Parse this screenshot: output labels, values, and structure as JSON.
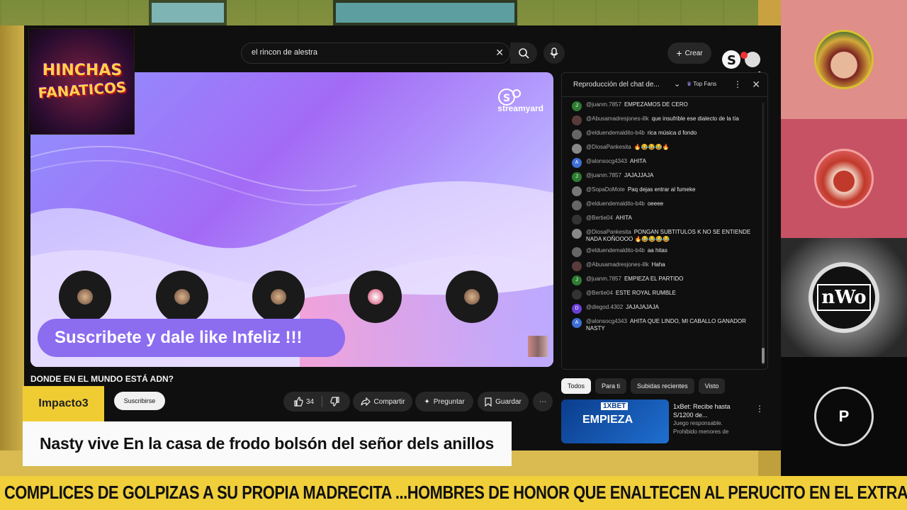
{
  "youtube": {
    "search_query": "el rincon de alestra",
    "create_label": "Crear",
    "streamyard_label": "streamyard",
    "video": {
      "banner_text": "Suscribete y dale like Infeliz !!!",
      "title": "DONDE EN EL MUNDO ESTÁ ADN?",
      "subscribe_label": "Suscribirse",
      "likes": "34",
      "share_label": "Compartir",
      "ask_label": "Preguntar",
      "save_label": "Guardar"
    },
    "chat": {
      "title": "Reproducción del chat de...",
      "top_fans": "Top Fans",
      "messages": [
        {
          "user": "@juanm.7857",
          "text": "EMPEZAMOS DE CERO",
          "initial": "J",
          "color": "#2e7d32"
        },
        {
          "user": "@Abusamadresjones-illk",
          "text": "que insufrible ese dialecto de la tía",
          "initial": "",
          "color": "#5a3b3b"
        },
        {
          "user": "@elduendemaldito-b4b",
          "text": "rica música d fondo",
          "initial": "",
          "color": "#666666"
        },
        {
          "user": "@DiosaPankesita",
          "text": "🔥😂😂😂🔥",
          "initial": "",
          "color": "#888888"
        },
        {
          "user": "@alonsocg4343",
          "text": "AHITA",
          "initial": "A",
          "color": "#3f6fd6"
        },
        {
          "user": "@juanm.7857",
          "text": "JAJAJJAJA",
          "initial": "J",
          "color": "#2e7d32"
        },
        {
          "user": "@SopaDoMote",
          "text": "Paq dejas entrar al fumeke",
          "initial": "",
          "color": "#777777"
        },
        {
          "user": "@elduendemaldito-b4b",
          "text": "oeeee",
          "initial": "",
          "color": "#666666"
        },
        {
          "user": "@Bertie04",
          "text": "AHITA",
          "initial": "",
          "color": "#333333"
        },
        {
          "user": "@DiosaPankesita",
          "text": "PONGAN SUBTITULOS K NO SE ENTIENDE NADA KOÑOOOO 🔥😂😂😂😂",
          "initial": "",
          "color": "#888888"
        },
        {
          "user": "@elduendemaldito-b4b",
          "text": "aa hitas",
          "initial": "",
          "color": "#666666"
        },
        {
          "user": "@Abusamadresjones-illk",
          "text": "Haha",
          "initial": "",
          "color": "#5a3b3b"
        },
        {
          "user": "@juanm.7857",
          "text": "EMPIEZA EL PARTIDO",
          "initial": "J",
          "color": "#2e7d32"
        },
        {
          "user": "@Bertie04",
          "text": "ESTE ROYAL RUMBLE",
          "initial": "",
          "color": "#333333"
        },
        {
          "user": "@diegod.4302",
          "text": "JAJAJAJAJA",
          "initial": "D",
          "color": "#6a3fd6"
        },
        {
          "user": "@alonsocg4343",
          "text": "AHITA QUE LINDO, MI CABALLO GANADOR NASTY",
          "initial": "A",
          "color": "#3f6fd6"
        }
      ]
    },
    "tabs": [
      "Todos",
      "Para ti",
      "Subidas recientes",
      "Visto"
    ],
    "ad": {
      "brand": "1XBET",
      "thumb_text": "EMPIEZA",
      "text": "1xBet: Recibe hasta S/1200 de...",
      "sub1": "Juego responsable.",
      "sub2": "Prohibido menores de"
    }
  },
  "overlay": {
    "logo_line1": "HINCHAS",
    "logo_line2": "FANATICOS",
    "caption_name": "Impacto3",
    "caption_text": "Nasty vive En la casa de frodo bolsón del señor dels anillos",
    "ticker": "COMPLICES DE GOLPIZAS A SU PROPIA MADRECITA ...HOMBRES DE HONOR QUE ENALTECEN AL PERUCITO EN EL EXTRANJERO"
  },
  "participants": {
    "p3_label": "nWo",
    "p4_initial": "P"
  }
}
